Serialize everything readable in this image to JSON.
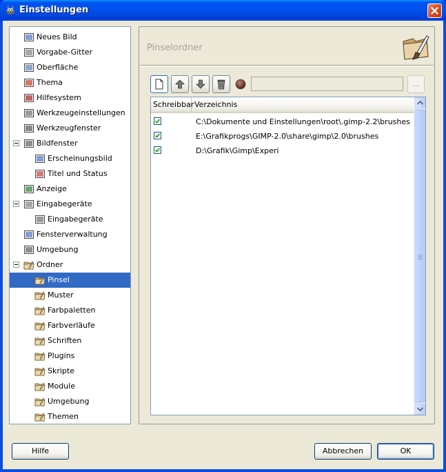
{
  "window": {
    "title": "Einstellungen",
    "title_icon": "gimp-wilber-icon",
    "close_icon": "close-icon"
  },
  "tree": {
    "items": [
      {
        "label": "Neues Bild",
        "icon": "new-image-icon",
        "depth": 0
      },
      {
        "label": "Vorgabe-Gitter",
        "icon": "grid-icon",
        "depth": 0
      },
      {
        "label": "Oberfläche",
        "icon": "interface-icon",
        "depth": 0
      },
      {
        "label": "Thema",
        "icon": "theme-icon",
        "depth": 0
      },
      {
        "label": "Hilfesystem",
        "icon": "help-system-icon",
        "depth": 0
      },
      {
        "label": "Werkzeugeinstellungen",
        "icon": "tool-options-icon",
        "depth": 0
      },
      {
        "label": "Werkzeugfenster",
        "icon": "toolbox-icon",
        "depth": 0
      },
      {
        "label": "Bildfenster",
        "icon": "image-window-icon",
        "depth": 0,
        "expanded": true
      },
      {
        "label": "Erscheinungsbild",
        "icon": "appearance-icon",
        "depth": 1
      },
      {
        "label": "Titel und Status",
        "icon": "title-status-icon",
        "depth": 1
      },
      {
        "label": "Anzeige",
        "icon": "display-icon",
        "depth": 0
      },
      {
        "label": "Eingabegeräte",
        "icon": "input-devices-icon",
        "depth": 0,
        "expanded": true
      },
      {
        "label": "Eingabegeräte",
        "icon": "input-controllers-icon",
        "depth": 1
      },
      {
        "label": "Fensterverwaltung",
        "icon": "window-management-icon",
        "depth": 0
      },
      {
        "label": "Umgebung",
        "icon": "environment-icon",
        "depth": 0
      },
      {
        "label": "Ordner",
        "icon": "folders-icon",
        "depth": 0,
        "expanded": true
      },
      {
        "label": "Pinsel",
        "icon": "folder-brushes-icon",
        "depth": 1,
        "selected": true
      },
      {
        "label": "Muster",
        "icon": "folder-patterns-icon",
        "depth": 1
      },
      {
        "label": "Farbpaletten",
        "icon": "folder-palettes-icon",
        "depth": 1
      },
      {
        "label": "Farbverläufe",
        "icon": "folder-gradients-icon",
        "depth": 1
      },
      {
        "label": "Schriften",
        "icon": "folder-fonts-icon",
        "depth": 1
      },
      {
        "label": "Plugins",
        "icon": "folder-plugins-icon",
        "depth": 1
      },
      {
        "label": "Skripte",
        "icon": "folder-scripts-icon",
        "depth": 1
      },
      {
        "label": "Module",
        "icon": "folder-modules-icon",
        "depth": 1
      },
      {
        "label": "Umgebung",
        "icon": "folder-environment-icon",
        "depth": 1
      },
      {
        "label": "Themen",
        "icon": "folder-themes-icon",
        "depth": 1
      }
    ]
  },
  "panel": {
    "title": "Pinselordner",
    "icon": "brush-folder-large-icon"
  },
  "toolbar": {
    "buttons": [
      {
        "name": "new-folder-button",
        "icon": "new-document-icon"
      },
      {
        "name": "move-up-button",
        "icon": "arrow-up-icon"
      },
      {
        "name": "move-down-button",
        "icon": "arrow-down-icon"
      },
      {
        "name": "delete-button",
        "icon": "trash-icon"
      }
    ],
    "status_icon": "status-dot-icon",
    "path_value": "",
    "browse_label": "..."
  },
  "list": {
    "columns": [
      "Schreibbar",
      "Verzeichnis"
    ],
    "rows": [
      {
        "writable": true,
        "path": "C:\\Dokumente und Einstellungen\\root\\.gimp-2.2\\brushes"
      },
      {
        "writable": true,
        "path": "E:\\Grafikprogs\\GIMP-2.0\\share\\gimp\\2.0\\brushes"
      },
      {
        "writable": true,
        "path": "D:\\Grafik\\Gimp\\Experi"
      }
    ]
  },
  "buttons": {
    "help": "Hilfe",
    "cancel": "Abbrechen",
    "ok": "OK"
  },
  "colors": {
    "selection": "#316ac5",
    "titlebar": "#0053ee",
    "dialog_bg": "#ece9d8"
  }
}
